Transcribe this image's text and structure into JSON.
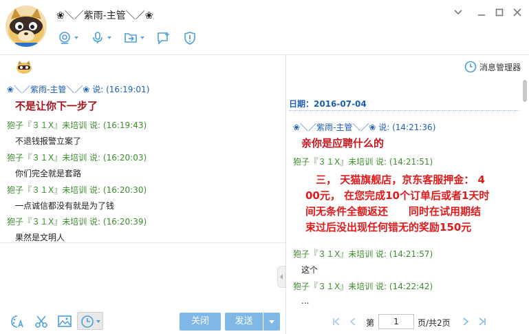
{
  "header": {
    "title": "❀＼／紫雨-主管＼／❀"
  },
  "left_chat": {
    "messages": [
      {
        "sender": "❀＼／紫雨-主管＼／❀ 说: (16:19:01)",
        "text": "不是让你下一步了",
        "style": "big",
        "color": "blue"
      },
      {
        "sender": "狍子『３１X』未培训 说: (16:19:43)",
        "text": "不退钱报警立案了",
        "style": "normal",
        "color": "green"
      },
      {
        "sender": "狍子『３１X』未培训 说: (16:20:03)",
        "text": "你们完全就是套路",
        "style": "normal",
        "color": "green"
      },
      {
        "sender": "狍子『３１X』未培训 说: (16:20:30)",
        "text": "一点诚信都没有就是为了钱",
        "style": "normal",
        "color": "green"
      },
      {
        "sender": "狍子『３１X』未培训 说: (16:20:39)",
        "text": "果然是文明人",
        "style": "normal",
        "color": "green"
      }
    ]
  },
  "buttons": {
    "close": "关闭",
    "send": "发送"
  },
  "right_pane": {
    "manager_label": "消息管理器",
    "date_label": "日期：2016-07-04",
    "messages": [
      {
        "sender": "❀＼／紫雨-主管＼／❀ 说: (14:21:36)",
        "text": "亲你是应聘什么的",
        "color": "blue"
      },
      {
        "sender": "狍子『３１X』未培训 说: (14:21:51)",
        "color": "green"
      },
      {
        "sender": "狍子『３１X』未培训 说: (14:21:57)",
        "text": "这个",
        "color": "green"
      },
      {
        "sender": "狍子『３１X』未培训 说: (14:22:42)",
        "text": "...",
        "color": "green"
      }
    ],
    "promo_lines": [
      "　三， 天猫旗舰店，京东客服押金： 4",
      "00元， 在您完成10个订单后或者1天时",
      "间无条件全额返还　　同时在试用期结",
      "束过后没出现任何错无的奖励150元"
    ]
  },
  "pager": {
    "label_di": "第",
    "current_page": "1",
    "label_total": "页/共2页"
  },
  "colors": {
    "blue_sender": "#1a5fb4",
    "green_sender": "#3c8c2c",
    "red_emphasis": "#c8141e",
    "button_blue": "#7fb8e6",
    "icon_blue": "#4a9fd8"
  }
}
